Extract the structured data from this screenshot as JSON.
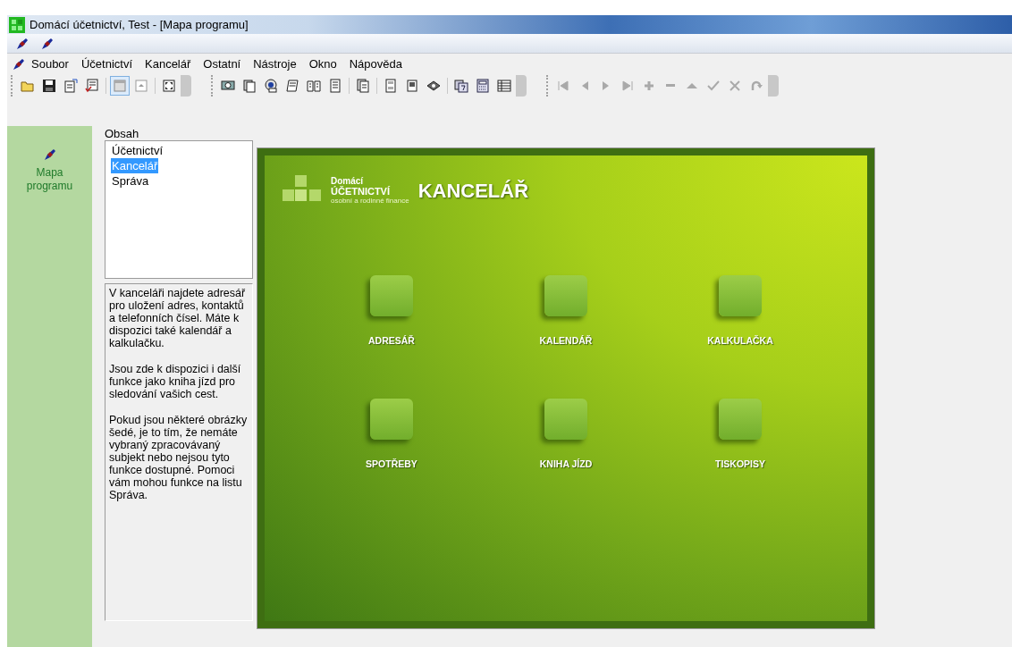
{
  "window": {
    "title": "Domácí účetnictví, Test - [Mapa programu]"
  },
  "menu": [
    {
      "label": "Soubor"
    },
    {
      "label": "Účetnictví"
    },
    {
      "label": "Kancelář"
    },
    {
      "label": "Ostatní"
    },
    {
      "label": "Nástroje"
    },
    {
      "label": "Okno"
    },
    {
      "label": "Nápověda"
    }
  ],
  "toolbars": [
    {
      "buttons": [
        {
          "pressed": false
        },
        {
          "pressed": false
        },
        {
          "pressed": false
        },
        {
          "pressed": false
        },
        {
          "pressed": true
        },
        {
          "pressed": false
        },
        {
          "pressed": false
        }
      ]
    },
    {
      "buttons": [
        {
          "pressed": false
        },
        {
          "pressed": false
        },
        {
          "pressed": false
        },
        {
          "pressed": false
        },
        {
          "pressed": false
        },
        {
          "pressed": false
        },
        {
          "pressed": false
        },
        {
          "pressed": false
        },
        {
          "pressed": false
        },
        {
          "pressed": false
        },
        {
          "pressed": false
        },
        {
          "pressed": false
        },
        {
          "pressed": false
        }
      ]
    },
    {
      "buttons": [
        {
          "disabled": true
        },
        {
          "disabled": true
        },
        {
          "disabled": true
        },
        {
          "disabled": true
        },
        {
          "disabled": true
        },
        {
          "disabled": true
        },
        {
          "disabled": true
        },
        {
          "disabled": true
        },
        {
          "disabled": true
        },
        {
          "disabled": true
        }
      ]
    }
  ],
  "sidebar": {
    "items": [
      {
        "label": "Mapa programu"
      }
    ]
  },
  "contents": {
    "label": "Obsah",
    "items": [
      {
        "label": "Účetnictví",
        "selected": false
      },
      {
        "label": "Kancelář",
        "selected": true
      },
      {
        "label": "Správa",
        "selected": false
      }
    ]
  },
  "description": {
    "paragraphs": [
      "V kanceláři najdete adresář pro uložení adres, kontaktů a telefonních čísel. Máte k dispozici také kalendář a kalkulačku.",
      "Jsou zde k dispozici i další funkce jako kniha jízd pro sledování vašich cest.",
      "Pokud jsou některé obrázky šedé, je to tím, že nemáte vybraný zpracovávaný subjekt nebo nejsou tyto funkce dostupné. Pomoci vám mohou funkce na listu Správa."
    ]
  },
  "module_panel": {
    "logo": {
      "line_1": "Domácí",
      "line_2": "ÚČETNICTVÍ",
      "line_3": "osobní a rodinné finance"
    },
    "title": "KANCELÁŘ",
    "modules": [
      {
        "label": "ADRESÁŘ"
      },
      {
        "label": "KALENDÁŘ"
      },
      {
        "label": "KALKULAČKA"
      },
      {
        "label": "SPOTŘEBY"
      },
      {
        "label": "KNIHA JÍZD"
      },
      {
        "label": "TISKOPISY"
      }
    ]
  }
}
